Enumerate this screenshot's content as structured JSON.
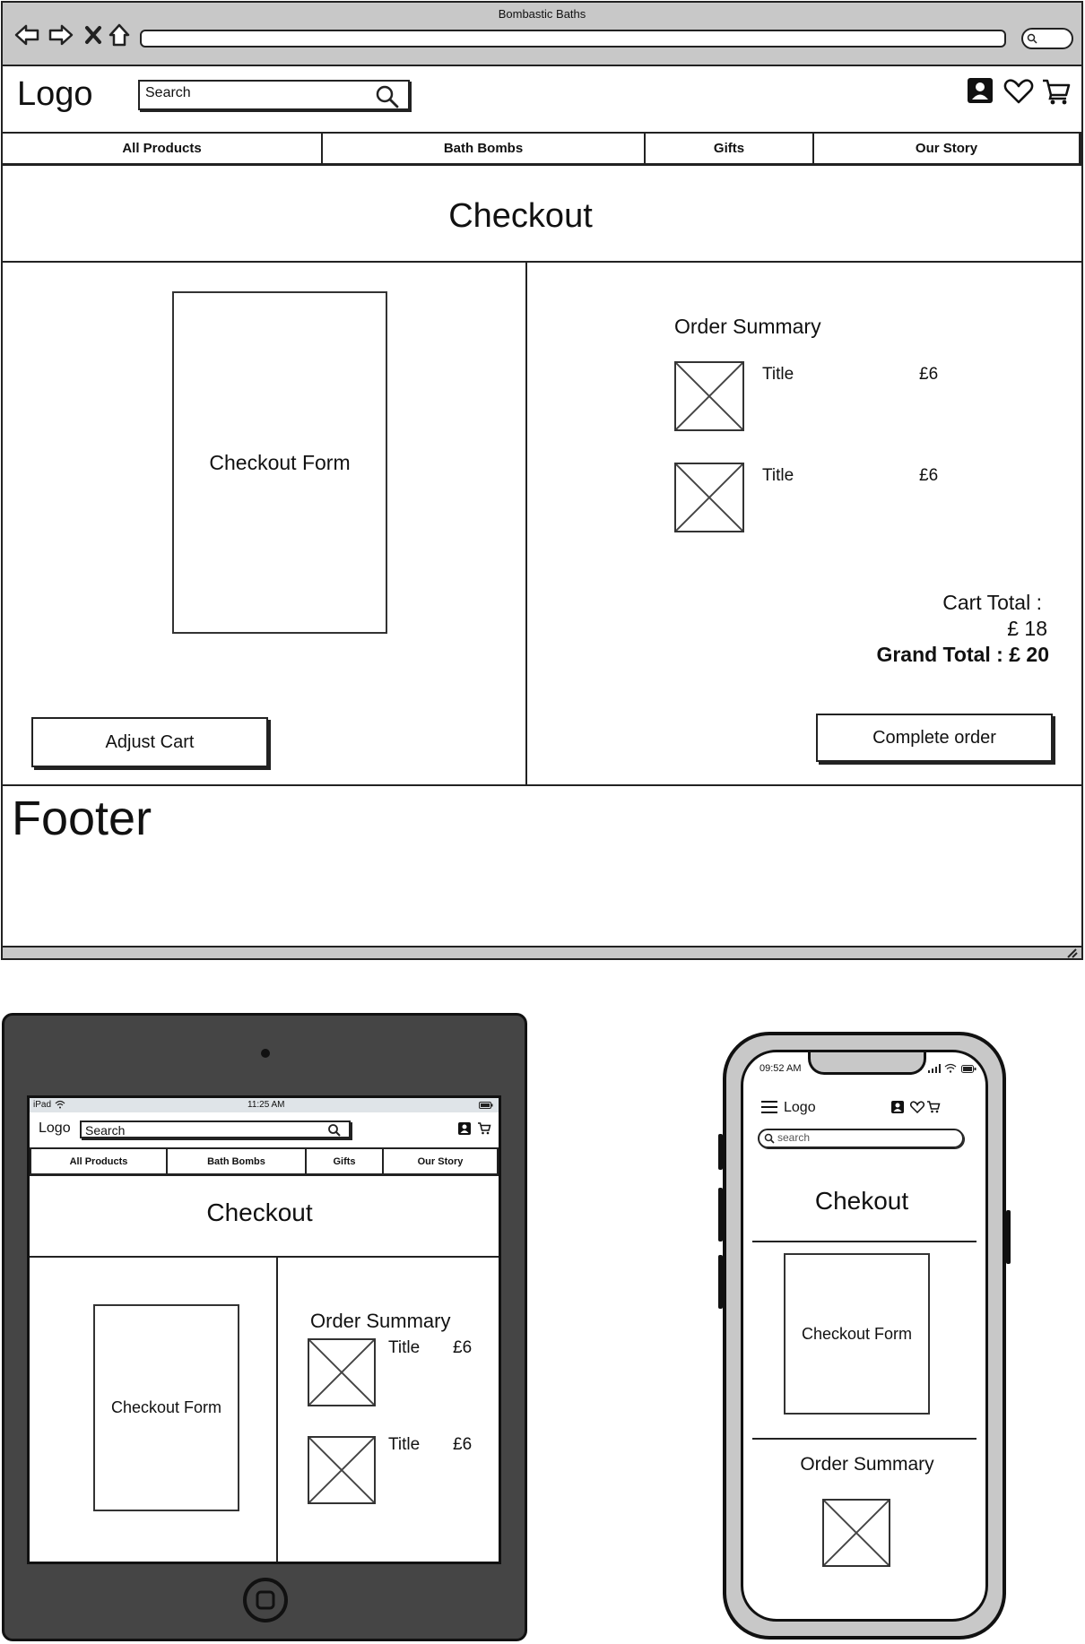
{
  "browser": {
    "title": "Bombastic Baths"
  },
  "desktop": {
    "header": {
      "logo": "Logo",
      "search_placeholder": "Search",
      "icons": [
        "account-icon",
        "heart-icon",
        "cart-icon"
      ]
    },
    "nav": [
      {
        "label": "All Products"
      },
      {
        "label": "Bath Bombs"
      },
      {
        "label": "Gifts"
      },
      {
        "label": "Our Story"
      }
    ],
    "page_title": "Checkout",
    "checkout_form_label": "Checkout Form",
    "adjust_cart_label": "Adjust Cart",
    "order_summary": {
      "heading": "Order Summary",
      "items": [
        {
          "title": "Title",
          "price": "£6"
        },
        {
          "title": "Title",
          "price": "£6"
        }
      ],
      "cart_total_label": "Cart Total :",
      "cart_total_value": "£ 18",
      "grand_total": "Grand Total : £ 20"
    },
    "complete_order_label": "Complete order",
    "footer_label": "Footer"
  },
  "tablet": {
    "status": {
      "device": "iPad",
      "time": "11:25 AM"
    },
    "logo": "Logo",
    "search_placeholder": "Search",
    "nav": [
      {
        "label": "All Products"
      },
      {
        "label": "Bath Bombs"
      },
      {
        "label": "Gifts"
      },
      {
        "label": "Our Story"
      }
    ],
    "page_title": "Checkout",
    "checkout_form_label": "Checkout Form",
    "order_summary": {
      "heading": "Order Summary",
      "items": [
        {
          "title": "Title",
          "price": "£6"
        },
        {
          "title": "Title",
          "price": "£6"
        }
      ]
    }
  },
  "mobile": {
    "status": {
      "time": "09:52 AM"
    },
    "logo": "Logo",
    "search_placeholder": "search",
    "page_title": "Chekout",
    "checkout_form_label": "Checkout Form",
    "order_summary_heading": "Order Summary"
  },
  "colors": {
    "outline": "#222222",
    "browser_chrome": "#c8c8c8",
    "tablet_body": "#454545",
    "ipad_status_bar": "#dfe4e8"
  }
}
